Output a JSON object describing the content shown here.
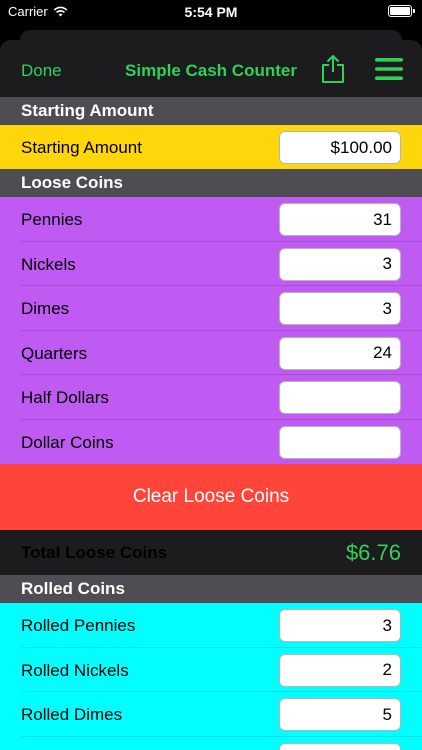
{
  "status_bar": {
    "carrier": "Carrier",
    "time": "5:54 PM"
  },
  "nav": {
    "done_label": "Done",
    "title": "Simple Cash Counter",
    "share_icon": "share-icon",
    "menu_icon": "hamburger-menu-icon"
  },
  "colors": {
    "accent": "#30d158",
    "starting_bg": "#ffd60a",
    "coins_bg": "#bf5af2",
    "rolled_bg": "#00ffff",
    "clear_bg": "#ff453a"
  },
  "starting_section": {
    "header": "Starting Amount",
    "label": "Starting Amount",
    "value": "$100.00"
  },
  "loose_coins": {
    "header": "Loose Coins",
    "rows": [
      {
        "label": "Pennies",
        "value": "31"
      },
      {
        "label": "Nickels",
        "value": "3"
      },
      {
        "label": "Dimes",
        "value": "3"
      },
      {
        "label": "Quarters",
        "value": "24"
      },
      {
        "label": "Half Dollars",
        "value": ""
      },
      {
        "label": "Dollar Coins",
        "value": ""
      }
    ],
    "clear_label": "Clear Loose Coins",
    "total_label": "Total Loose Coins",
    "total_value": "$6.76"
  },
  "rolled_coins": {
    "header": "Rolled Coins",
    "rows": [
      {
        "label": "Rolled Pennies",
        "value": "3"
      },
      {
        "label": "Rolled Nickels",
        "value": "2"
      },
      {
        "label": "Rolled Dimes",
        "value": "5"
      },
      {
        "label": "",
        "value": ""
      }
    ]
  }
}
